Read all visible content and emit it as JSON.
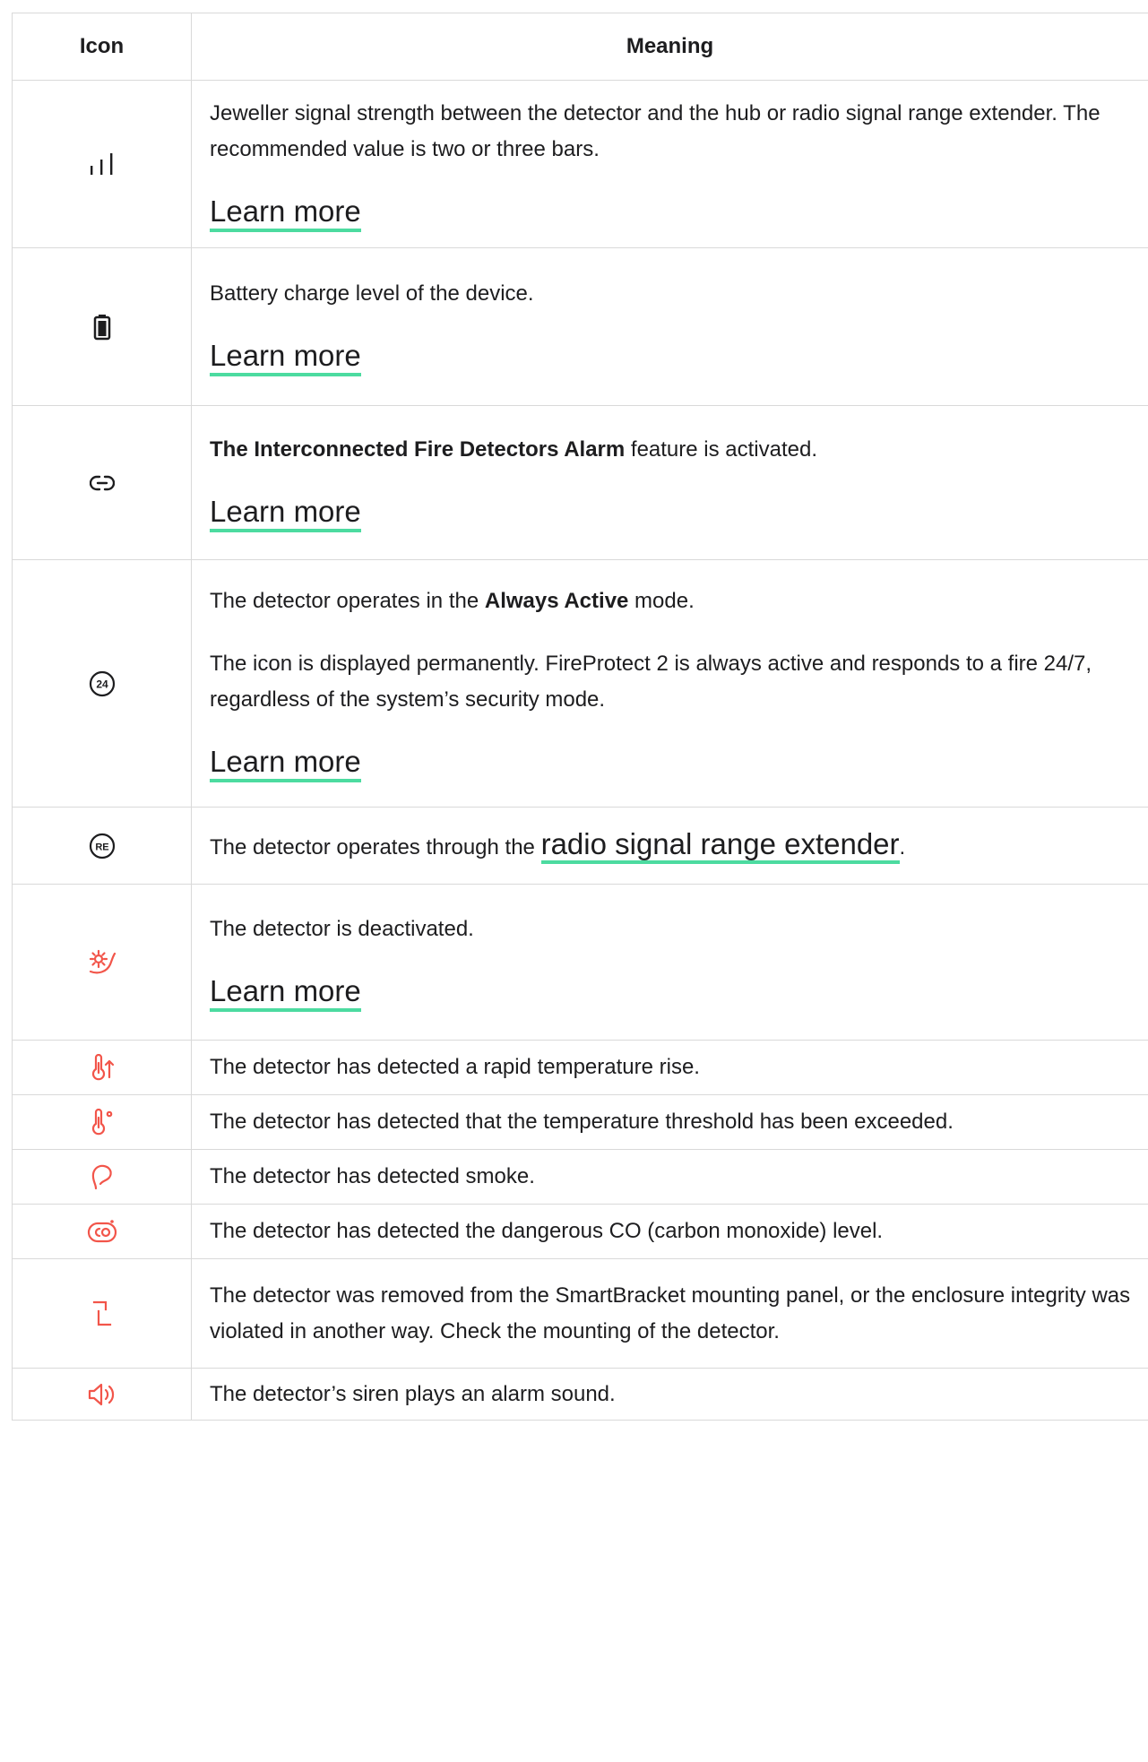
{
  "header": {
    "icon": "Icon",
    "meaning": "Meaning"
  },
  "colors": {
    "accent_underline": "#4cdba0",
    "alert_icon": "#f2554a",
    "text": "#1d1d1f",
    "border": "#d9d9d9"
  },
  "rows": [
    {
      "icon": "signal-strength-icon",
      "text": "Jeweller signal strength between the detector and the hub or radio signal range extender. The recommended value is two or three bars.",
      "link": "Learn more"
    },
    {
      "icon": "battery-icon",
      "text": "Battery charge level of the device.",
      "link": "Learn more"
    },
    {
      "icon": "link-icon",
      "bold": "The Interconnected Fire Detectors Alarm",
      "after": " feature is activated.",
      "link": "Learn more"
    },
    {
      "icon": "always-active-24-icon",
      "before": "The detector operates in the ",
      "bold": "Always Active",
      "after": " mode.",
      "para2": "The icon is displayed permanently. FireProtect 2 is always active and responds to a fire 24/7, regardless of the system’s security mode.",
      "link": "Learn more"
    },
    {
      "icon": "range-extender-re-icon",
      "before": "The detector operates through the ",
      "link": "radio signal range extender",
      "after": "."
    },
    {
      "icon": "deactivated-gear-icon",
      "text": "The detector is deactivated.",
      "link": "Learn more"
    },
    {
      "icon": "temperature-rise-icon",
      "text": "The detector has detected a rapid temperature rise."
    },
    {
      "icon": "temperature-threshold-icon",
      "text": "The detector has detected that the temperature threshold has been exceeded."
    },
    {
      "icon": "smoke-icon",
      "text": "The detector has detected smoke."
    },
    {
      "icon": "co-icon",
      "text": "The detector has detected the dangerous CO (carbon monoxide) level."
    },
    {
      "icon": "tamper-icon",
      "text": "The detector was removed from the SmartBracket mounting panel, or the enclosure integrity was violated in another way. Check the mounting of the detector."
    },
    {
      "icon": "siren-speaker-icon",
      "text": "The detector’s siren plays an alarm sound."
    }
  ]
}
